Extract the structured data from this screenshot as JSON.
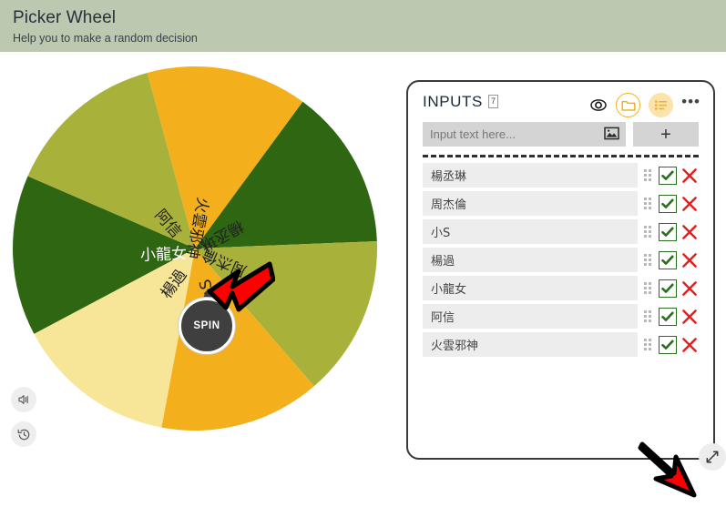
{
  "header": {
    "title": "Picker Wheel",
    "subtitle": "Help you to make a random decision",
    "band_color": "#bcc8b0"
  },
  "wheel": {
    "spin_label": "SPIN",
    "hub_color": "#3f3f3f",
    "sound_icon": "speaker-icon",
    "history_icon": "history-icon",
    "segments": [
      {
        "label": "小龍女",
        "color": "#2e6612",
        "text_color": "#ffffff"
      },
      {
        "label": "阿信",
        "color": "#a8b13a",
        "text_color": "#222222"
      },
      {
        "label": "火雲邪神",
        "color": "#f3b01c",
        "text_color": "#222222"
      },
      {
        "label": "楊丞琳",
        "color": "#2e6612",
        "text_color": "#222222"
      },
      {
        "label": "周杰倫",
        "color": "#a8b13a",
        "text_color": "#222222"
      },
      {
        "label": "小S",
        "color": "#f3b01c",
        "text_color": "#222222"
      },
      {
        "label": "楊過",
        "color": "#f7e698",
        "text_color": "#222222"
      }
    ]
  },
  "panel": {
    "title": "INPUTS",
    "count": "7",
    "eye_icon": "eye-icon",
    "folder_icon": "folder-icon",
    "list_icon": "list-icon",
    "more_label": "•••",
    "input_placeholder": "Input text here...",
    "input_value": "",
    "image_icon": "image-icon",
    "add_label": "+",
    "expand_icon": "expand-icon",
    "items": [
      {
        "name": "楊丞琳",
        "checked": true
      },
      {
        "name": "周杰倫",
        "checked": true
      },
      {
        "name": "小S",
        "checked": true
      },
      {
        "name": "楊過",
        "checked": true
      },
      {
        "name": "小龍女",
        "checked": true
      },
      {
        "name": "阿信",
        "checked": true
      },
      {
        "name": "火雲邪神",
        "checked": true
      }
    ]
  },
  "annotations": {
    "arrow_color": "#fe0000",
    "arrow_outline": "#000000",
    "spin_arrow": "arrow-pointing-to-spin",
    "expand_arrow": "arrow-pointing-to-expand"
  }
}
